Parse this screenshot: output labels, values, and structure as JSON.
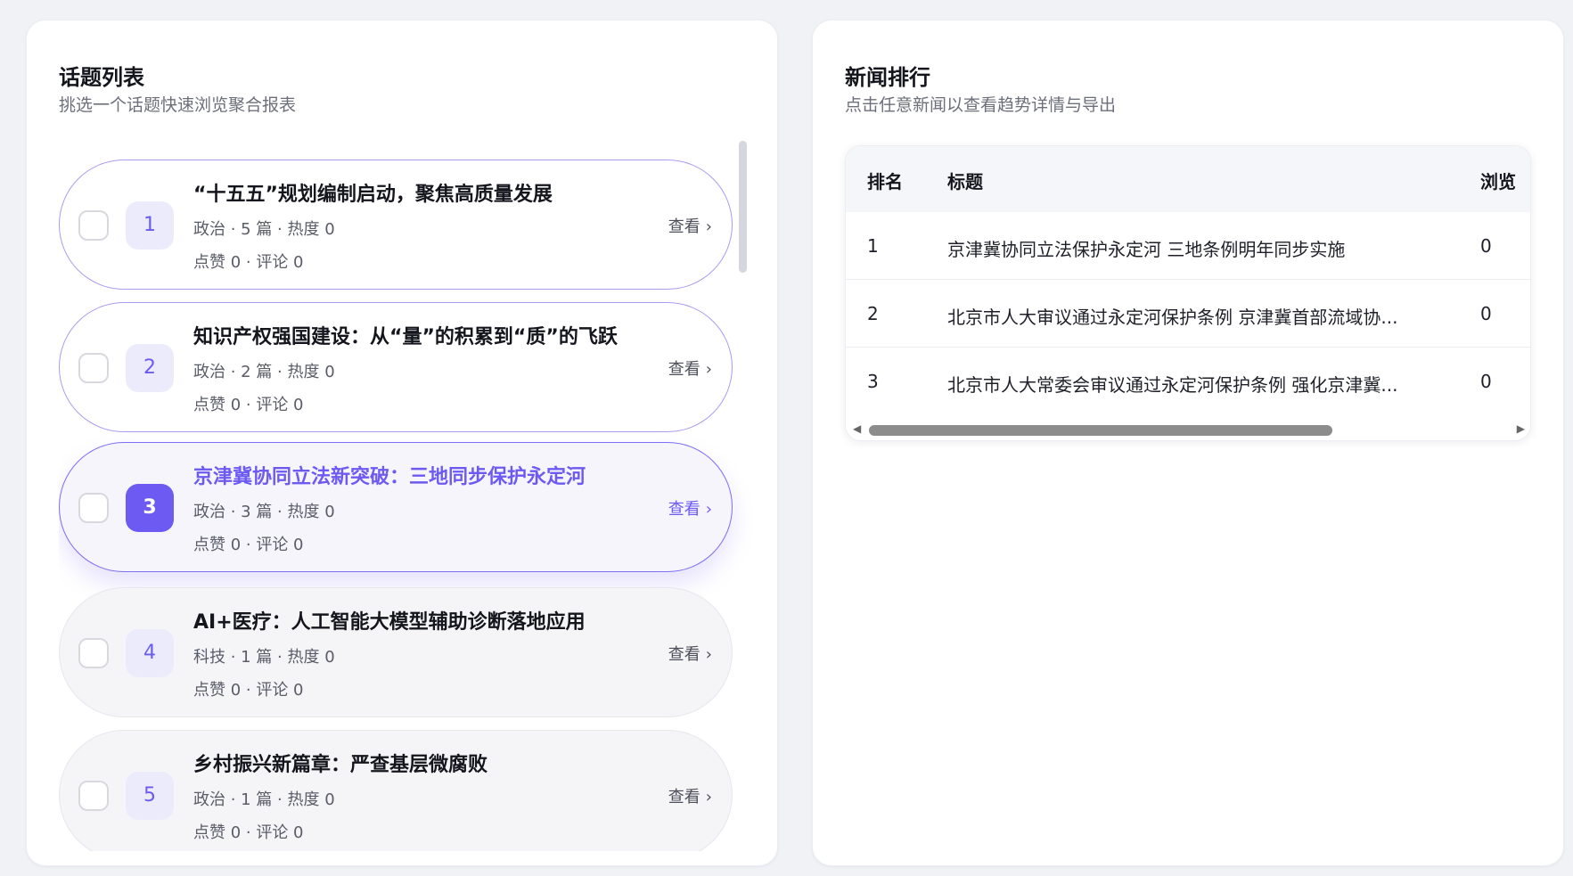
{
  "topics_panel": {
    "title": "话题列表",
    "subtitle": "挑选一个话题快速浏览聚合报表",
    "items": [
      {
        "rank": "1",
        "title": "“十五五”规划编制启动，聚焦高质量发展",
        "meta1": "政治 · 5 篇 · 热度 0",
        "meta2": "点赞 0 · 评论 0",
        "view": "查看",
        "state": "selected"
      },
      {
        "rank": "2",
        "title": "知识产权强国建设：从“量”的积累到“质”的飞跃",
        "meta1": "政治 · 2 篇 · 热度 0",
        "meta2": "点赞 0 · 评论 0",
        "view": "查看",
        "state": "selected"
      },
      {
        "rank": "3",
        "title": "京津冀协同立法新突破：三地同步保护永定河",
        "meta1": "政治 · 3 篇 · 热度 0",
        "meta2": "点赞 0 · 评论 0",
        "view": "查看",
        "state": "active"
      },
      {
        "rank": "4",
        "title": "AI+医疗：人工智能大模型辅助诊断落地应用",
        "meta1": "科技 · 1 篇 · 热度 0",
        "meta2": "点赞 0 · 评论 0",
        "view": "查看",
        "state": "normal"
      },
      {
        "rank": "5",
        "title": "乡村振兴新篇章：严查基层微腐败",
        "meta1": "政治 · 1 篇 · 热度 0",
        "meta2": "点赞 0 · 评论 0",
        "view": "查看",
        "state": "normal"
      }
    ]
  },
  "news_panel": {
    "title": "新闻排行",
    "subtitle": "点击任意新闻以查看趋势详情与导出",
    "headers": {
      "rank": "排名",
      "title": "标题",
      "views": "浏览"
    },
    "rows": [
      {
        "rank": "1",
        "title": "京津冀协同立法保护永定河 三地条例明年同步实施",
        "views": "0"
      },
      {
        "rank": "2",
        "title": "北京市人大审议通过永定河保护条例 京津冀首部流域协...",
        "views": "0"
      },
      {
        "rank": "3",
        "title": "北京市人大常委会审议通过永定河保护条例 强化京津冀...",
        "views": "0"
      }
    ]
  },
  "icons": {
    "chevron": "›",
    "scroll_left": "◀",
    "scroll_right": "▶"
  },
  "colors": {
    "accent": "#6c5af2",
    "accent_light": "#ecebfc",
    "background": "#f1f2f6"
  }
}
